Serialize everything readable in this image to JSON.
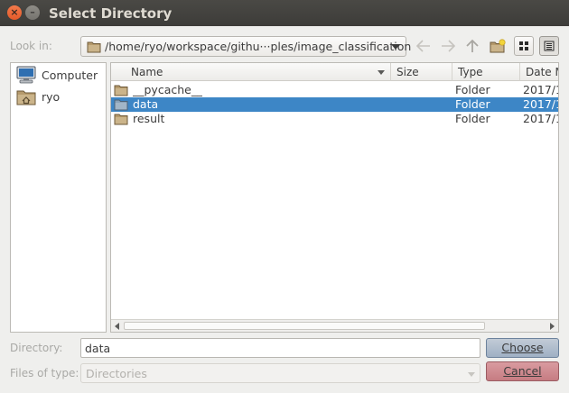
{
  "window": {
    "title": "Select Directory",
    "close_glyph": "×",
    "minimize_glyph": "–"
  },
  "toolbar": {
    "look_in_label": "Look in:",
    "path": "/home/ryo/workspace/githu···ples/image_classification",
    "back_icon": "back-arrow-icon",
    "forward_icon": "forward-arrow-icon",
    "up_icon": "parent-directory-icon",
    "new_folder_icon": "new-folder-icon",
    "list_view_icon": "list-view-icon",
    "detail_view_icon": "detail-view-icon"
  },
  "sidebar": {
    "items": [
      {
        "label": "Computer",
        "icon": "computer-icon"
      },
      {
        "label": "ryo",
        "icon": "home-folder-icon"
      }
    ]
  },
  "filelist": {
    "columns": [
      "Name",
      "Size",
      "Type",
      "Date M"
    ],
    "rows": [
      {
        "name": "__pycache__",
        "size": "",
        "type": "Folder",
        "date": "2017/1",
        "selected": false
      },
      {
        "name": "data",
        "size": "",
        "type": "Folder",
        "date": "2017/1",
        "selected": true
      },
      {
        "name": "result",
        "size": "",
        "type": "Folder",
        "date": "2017/1",
        "selected": false
      }
    ]
  },
  "footer": {
    "directory_label": "Directory:",
    "directory_value": "data",
    "files_of_type_label": "Files of type:",
    "files_of_type_value": "Directories",
    "choose_label": "Choose",
    "cancel_label": "Cancel"
  },
  "colors": {
    "selection": "#3d86c6",
    "titlebar": "#3d3c39",
    "close_button": "#e35a2a",
    "choose_button": "#9fb0c4",
    "cancel_button": "#c67c82"
  }
}
